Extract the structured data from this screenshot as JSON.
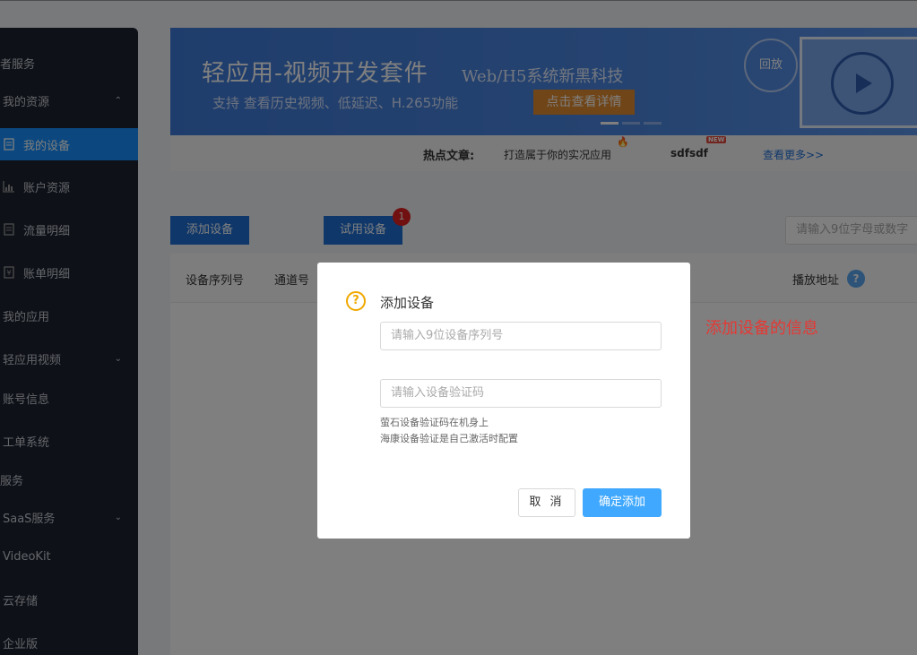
{
  "sidebar": {
    "items": [
      {
        "label": "者服务",
        "icon": "none",
        "chevron": ""
      },
      {
        "label": "我的资源",
        "icon": "none",
        "chevron": "^"
      },
      {
        "label": "我的设备",
        "icon": "document-icon",
        "chevron": "",
        "active": true
      },
      {
        "label": "账户资源",
        "icon": "chart-icon",
        "chevron": ""
      },
      {
        "label": "流量明细",
        "icon": "document-icon",
        "chevron": ""
      },
      {
        "label": "账单明细",
        "icon": "bill-icon",
        "chevron": ""
      },
      {
        "label": "我的应用",
        "icon": "none",
        "chevron": ""
      },
      {
        "label": "轻应用视频",
        "icon": "none",
        "chevron": "v"
      },
      {
        "label": "账号信息",
        "icon": "none",
        "chevron": ""
      },
      {
        "label": "工单系统",
        "icon": "none",
        "chevron": ""
      },
      {
        "label": "服务",
        "icon": "none",
        "chevron": ""
      },
      {
        "label": "SaaS服务",
        "icon": "none",
        "chevron": "v"
      },
      {
        "label": "VideoKit",
        "icon": "none",
        "chevron": ""
      },
      {
        "label": "云存储",
        "icon": "none",
        "chevron": ""
      },
      {
        "label": "企业版",
        "icon": "none",
        "chevron": ""
      }
    ]
  },
  "banner": {
    "title": "轻应用-视频开发套件",
    "subtitle": "Web/H5系统新黑科技",
    "description": "支持 查看历史视频、低延迟、H.265功能",
    "cta": "点击查看详情",
    "replay": "回放"
  },
  "hot": {
    "label": "热点文章:",
    "article1": "打造属于你的实况应用",
    "article2": "sdfsdf",
    "new_badge": "NEW",
    "more": "查看更多>>"
  },
  "toolbar": {
    "add_device": "添加设备",
    "trial_device": "试用设备",
    "trial_badge": "1",
    "search_placeholder": "请输入9位字母或数字"
  },
  "table": {
    "headers": [
      "设备序列号",
      "通道号",
      "播放地址"
    ]
  },
  "modal": {
    "title": "添加设备",
    "serial_placeholder": "请输入9位设备序列号",
    "code_placeholder": "请输入设备验证码",
    "hint1": "萤石设备验证码在机身上",
    "hint2": "海康设备验证是自己激活时配置",
    "cancel": "取 消",
    "confirm": "确定添加"
  },
  "annotation": "添加设备的信息"
}
